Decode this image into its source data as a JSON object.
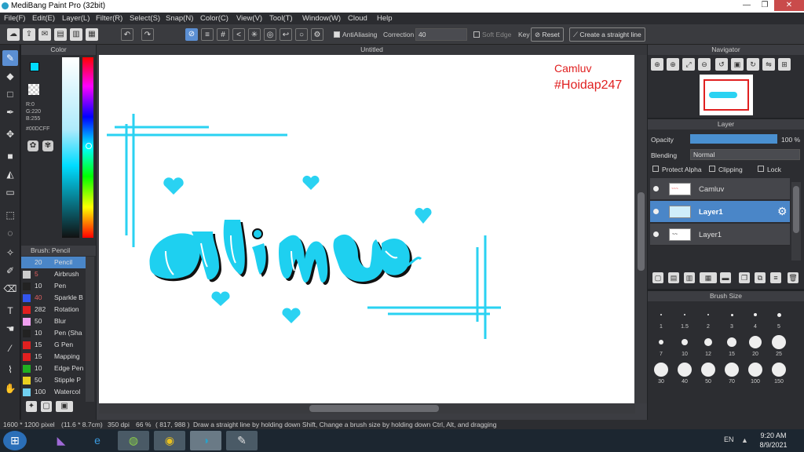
{
  "window": {
    "title": "MediBang Paint Pro (32bit)",
    "min": "—",
    "max": "❐",
    "close": "✕"
  },
  "menu": [
    "File(F)",
    "Edit(E)",
    "Layer(L)",
    "Filter(R)",
    "Select(S)",
    "Snap(N)",
    "Color(C)",
    "View(V)",
    "Tool(T)",
    "Window(W)",
    "Cloud",
    "Help"
  ],
  "toolbar": {
    "antialiasing": "AntiAliasing",
    "correction_label": "Correction",
    "correction_value": "40",
    "soft_edge": "Soft Edge",
    "key": "Key",
    "reset": "Reset",
    "straight_line": "Create a straight line"
  },
  "color_panel": {
    "title": "Color",
    "r": "R:0",
    "g": "G:220",
    "b": "B:255",
    "hex": "#00DCFF",
    "primary": "#00dcff",
    "secondary": "#e02020"
  },
  "brush_panel": {
    "title": "Brush: Pencil",
    "brushes": [
      {
        "size": "20",
        "name": "Pencil",
        "color": "#4a86c8"
      },
      {
        "size": "5",
        "name": "Airbrush",
        "color": "#cccccc"
      },
      {
        "size": "10",
        "name": "Pen",
        "color": "#222222"
      },
      {
        "size": "40",
        "name": "Sparkle B",
        "color": "#3355ee"
      },
      {
        "size": "282",
        "name": "Rotation",
        "color": "#e02020"
      },
      {
        "size": "50",
        "name": "Blur",
        "color": "#f0a0f0"
      },
      {
        "size": "10",
        "name": "Pen (Sha",
        "color": "#222222"
      },
      {
        "size": "15",
        "name": "G Pen",
        "color": "#e02020"
      },
      {
        "size": "15",
        "name": "Mapping",
        "color": "#e02020"
      },
      {
        "size": "10",
        "name": "Edge Pen",
        "color": "#20b020"
      },
      {
        "size": "50",
        "name": "Stipple P",
        "color": "#e8d020"
      },
      {
        "size": "100",
        "name": "Watercol",
        "color": "#70d0f0"
      }
    ]
  },
  "canvas": {
    "tab": "Untitled",
    "watermark_line1": "Camluv",
    "watermark_line2": "#Hoidap247"
  },
  "navigator": {
    "title": "Navigator"
  },
  "layer_panel": {
    "title": "Layer",
    "opacity_label": "Opacity",
    "opacity_value": "100 %",
    "blending_label": "Blending",
    "blending_value": "Normal",
    "protect_alpha": "Protect Alpha",
    "clipping": "Clipping",
    "lock": "Lock",
    "layers": [
      "Camluv",
      "Layer1",
      "Layer1"
    ]
  },
  "brush_size": {
    "title": "Brush Size",
    "labels": [
      "1",
      "1.5",
      "2",
      "3",
      "4",
      "5",
      "7",
      "10",
      "12",
      "15",
      "20",
      "25",
      "30",
      "40",
      "50",
      "70",
      "100",
      "150"
    ]
  },
  "status": {
    "size": "1600 * 1200 pixel",
    "physical": "(11.6 * 8.7cm)",
    "dpi": "350 dpi",
    "zoom": "66 %",
    "coords": "( 817, 988 )",
    "hint": "Draw a straight line by holding down Shift, Change a brush size by holding down Ctrl, Alt, and dragging"
  },
  "taskbar": {
    "lang": "EN",
    "time": "9:20 AM",
    "date": "8/9/2021"
  }
}
